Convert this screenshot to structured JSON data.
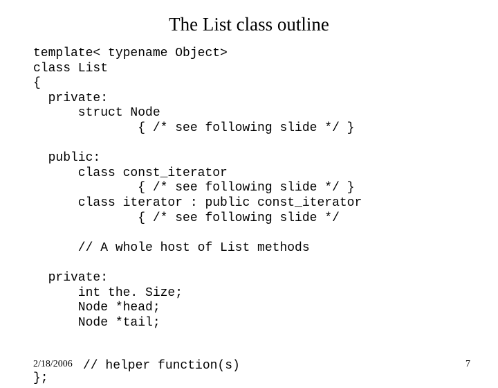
{
  "title": "The List class outline",
  "code": {
    "l1": "template< typename Object>",
    "l2": "class List",
    "l3": "{",
    "l4": "  private:",
    "l5": "      struct Node",
    "l6": "              { /* see following slide */ }",
    "l7": "",
    "l8": "  public:",
    "l9": "      class const_iterator",
    "l10": "              { /* see following slide */ }",
    "l11": "      class iterator : public const_iterator",
    "l12": "              { /* see following slide */",
    "l13": "",
    "l14": "      // A whole host of List methods",
    "l15": "",
    "l16": "  private:",
    "l17": "      int the. Size;",
    "l18": "      Node *head;",
    "l19": "      Node *tail;"
  },
  "helper": "// helper function(s)",
  "closing": "};",
  "footer": {
    "date": "2/18/2006",
    "page": "7"
  }
}
